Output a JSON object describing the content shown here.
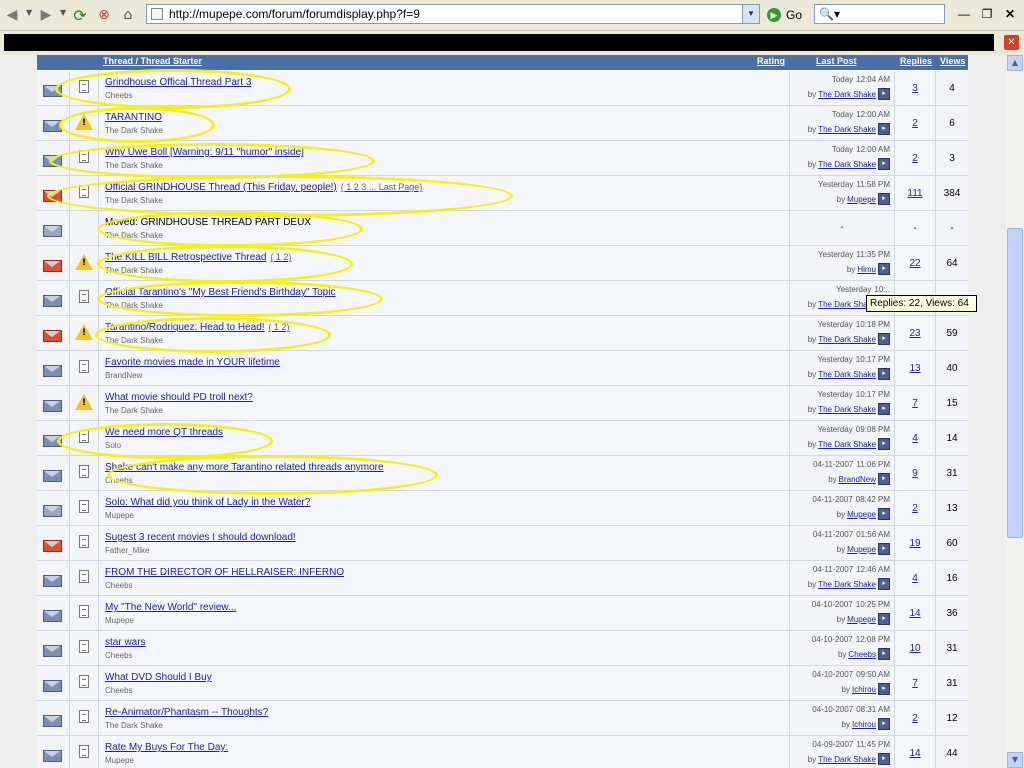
{
  "browser": {
    "url": "http://mupepe.com/forum/forumdisplay.php?f=9",
    "go_label": "Go"
  },
  "header": {
    "thread": "Thread / Thread Starter",
    "rating": "Rating",
    "last_post": "Last Post",
    "replies": "Replies",
    "views": "Views"
  },
  "tooltip": "Replies: 22, Views: 64",
  "threads": [
    {
      "title": "Grindhouse Offical Thread Part 3",
      "starter": "Cheebs",
      "date": "Today",
      "time": "12:04 AM",
      "by": "The Dark Shake",
      "replies": "3",
      "views": "4",
      "icon": "env",
      "post": "doc"
    },
    {
      "title": "TARANTINO",
      "starter": "The Dark Shake",
      "date": "Today",
      "time": "12:00 AM",
      "by": "The Dark Shake",
      "replies": "2",
      "views": "6",
      "icon": "env",
      "post": "warn"
    },
    {
      "title": "Why Uwe Boll [Warning: 9/11 \"humor\" inside]",
      "starter": "The Dark Shake",
      "date": "Today",
      "time": "12:00 AM",
      "by": "The Dark Shake",
      "replies": "2",
      "views": "3",
      "icon": "env",
      "post": "doc"
    },
    {
      "title": "Official GRINDHOUSE Thread (This Friday, people!)",
      "pages": "( 1 2 3 ... Last Page)",
      "starter": "The Dark Shake",
      "date": "Yesterday",
      "time": "11:58 PM",
      "by": "Mupepe",
      "replies": "111",
      "views": "384",
      "icon": "hot",
      "post": "doc"
    },
    {
      "title": "Moved: GRINDHOUSE THREAD PART DEUX",
      "starter": "The Dark Shake",
      "date": "",
      "time": "",
      "by": "",
      "replies": "-",
      "views": "-",
      "icon": "moved",
      "post": "none",
      "lastpost": "-"
    },
    {
      "title": "The KILL BILL Retrospective Thread",
      "pages": "( 1 2)",
      "starter": "The Dark Shake",
      "date": "Yesterday",
      "time": "11:35 PM",
      "by": "Himu",
      "replies": "22",
      "views": "64",
      "icon": "hot",
      "post": "warn"
    },
    {
      "title": "Official Tarantino's \"My Best Friend's Birthday\" Topic",
      "starter": "The Dark Shake",
      "date": "Yesterday",
      "time": "10:..",
      "by": "The Dark Shake",
      "replies": "",
      "views": "",
      "icon": "env",
      "post": "doc"
    },
    {
      "title": "Tarantino/Rodriquez: Head to Head!",
      "pages": "( 1 2)",
      "starter": "The Dark Shake",
      "date": "Yesterday",
      "time": "10:18 PM",
      "by": "The Dark Shake",
      "replies": "23",
      "views": "59",
      "icon": "hot",
      "post": "warn"
    },
    {
      "title": "Favorite movies made in YOUR lifetime",
      "starter": "BrandNew",
      "date": "Yesterday",
      "time": "10:17 PM",
      "by": "The Dark Shake",
      "replies": "13",
      "views": "40",
      "icon": "env",
      "post": "doc"
    },
    {
      "title": "What movie should PD troll next?",
      "starter": "The Dark Shake",
      "date": "Yesterday",
      "time": "10:17 PM",
      "by": "The Dark Shake",
      "replies": "7",
      "views": "15",
      "icon": "env",
      "post": "warn"
    },
    {
      "title": "We need more QT threads",
      "starter": "Solo",
      "date": "Yesterday",
      "time": "09:08 PM",
      "by": "The Dark Shake",
      "replies": "4",
      "views": "14",
      "icon": "env",
      "post": "doc"
    },
    {
      "title": "Shake can't make any more Tarantino related threads anymore",
      "starter": "Cheebs",
      "date": "04-11-2007",
      "time": "11:06 PM",
      "by": "BrandNew",
      "replies": "9",
      "views": "31",
      "icon": "env",
      "post": "doc"
    },
    {
      "title": "Solo: What did you think of Lady in the Water?",
      "starter": "Mupepe",
      "date": "04-11-2007",
      "time": "08:42 PM",
      "by": "Mupepe",
      "replies": "2",
      "views": "13",
      "icon": "moved",
      "post": "doc"
    },
    {
      "title": "Sugest 3 recent movies I should download!",
      "starter": "Father_Mike",
      "date": "04-11-2007",
      "time": "01:56 AM",
      "by": "Mupepe",
      "replies": "19",
      "views": "60",
      "icon": "hot",
      "post": "doc"
    },
    {
      "title": "FROM THE DIRECTOR OF HELLRAISER: INFERNO",
      "starter": "Cheebs",
      "date": "04-11-2007",
      "time": "12:46 AM",
      "by": "The Dark Shake",
      "replies": "4",
      "views": "16",
      "icon": "env",
      "post": "doc"
    },
    {
      "title": "My \"The New World\" review...",
      "starter": "Mupepe",
      "date": "04-10-2007",
      "time": "10:25 PM",
      "by": "Mupepe",
      "replies": "14",
      "views": "36",
      "icon": "env",
      "post": "doc"
    },
    {
      "title": "star wars",
      "starter": "Cheebs",
      "date": "04-10-2007",
      "time": "12:08 PM",
      "by": "Cheebs",
      "replies": "10",
      "views": "31",
      "icon": "env",
      "post": "doc"
    },
    {
      "title": "What DVD Should I Buy",
      "starter": "Cheebs",
      "date": "04-10-2007",
      "time": "09:50 AM",
      "by": "Ichirou",
      "replies": "7",
      "views": "31",
      "icon": "env",
      "post": "doc"
    },
    {
      "title": "Re-Animator/Phantasm -- Thoughts?",
      "starter": "The Dark Shake",
      "date": "04-10-2007",
      "time": "08:31 AM",
      "by": "Ichirou",
      "replies": "2",
      "views": "12",
      "icon": "env",
      "post": "doc"
    },
    {
      "title": "Rate My Buys For The Day:",
      "starter": "Mupepe",
      "date": "04-09-2007",
      "time": "11:45 PM",
      "by": "The Dark Shake",
      "replies": "14",
      "views": "44",
      "icon": "env",
      "post": "doc"
    }
  ],
  "colors": {
    "header_bg": "#4a6fa8",
    "link": "#22229c",
    "highlighter": "#f6f014",
    "tooltip_bg": "#ffffe1"
  }
}
